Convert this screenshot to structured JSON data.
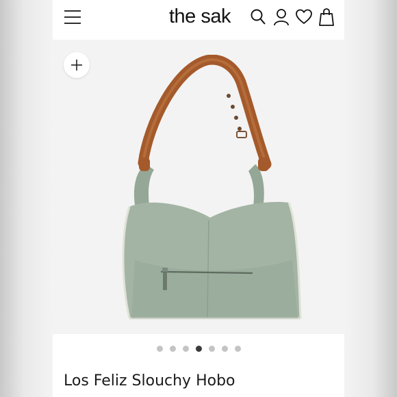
{
  "header": {
    "brand": "the sak",
    "icons": [
      "menu-icon",
      "search-icon",
      "account-icon",
      "heart-icon",
      "shopping-bag-icon"
    ]
  },
  "gallery": {
    "zoom_icon": "plus-icon",
    "slide_count": 7,
    "active_slide": 4,
    "product_color": "#a3b4a4",
    "strap_color": "#a45a2b"
  },
  "product": {
    "title": "Los Feliz Slouchy Hobo"
  }
}
